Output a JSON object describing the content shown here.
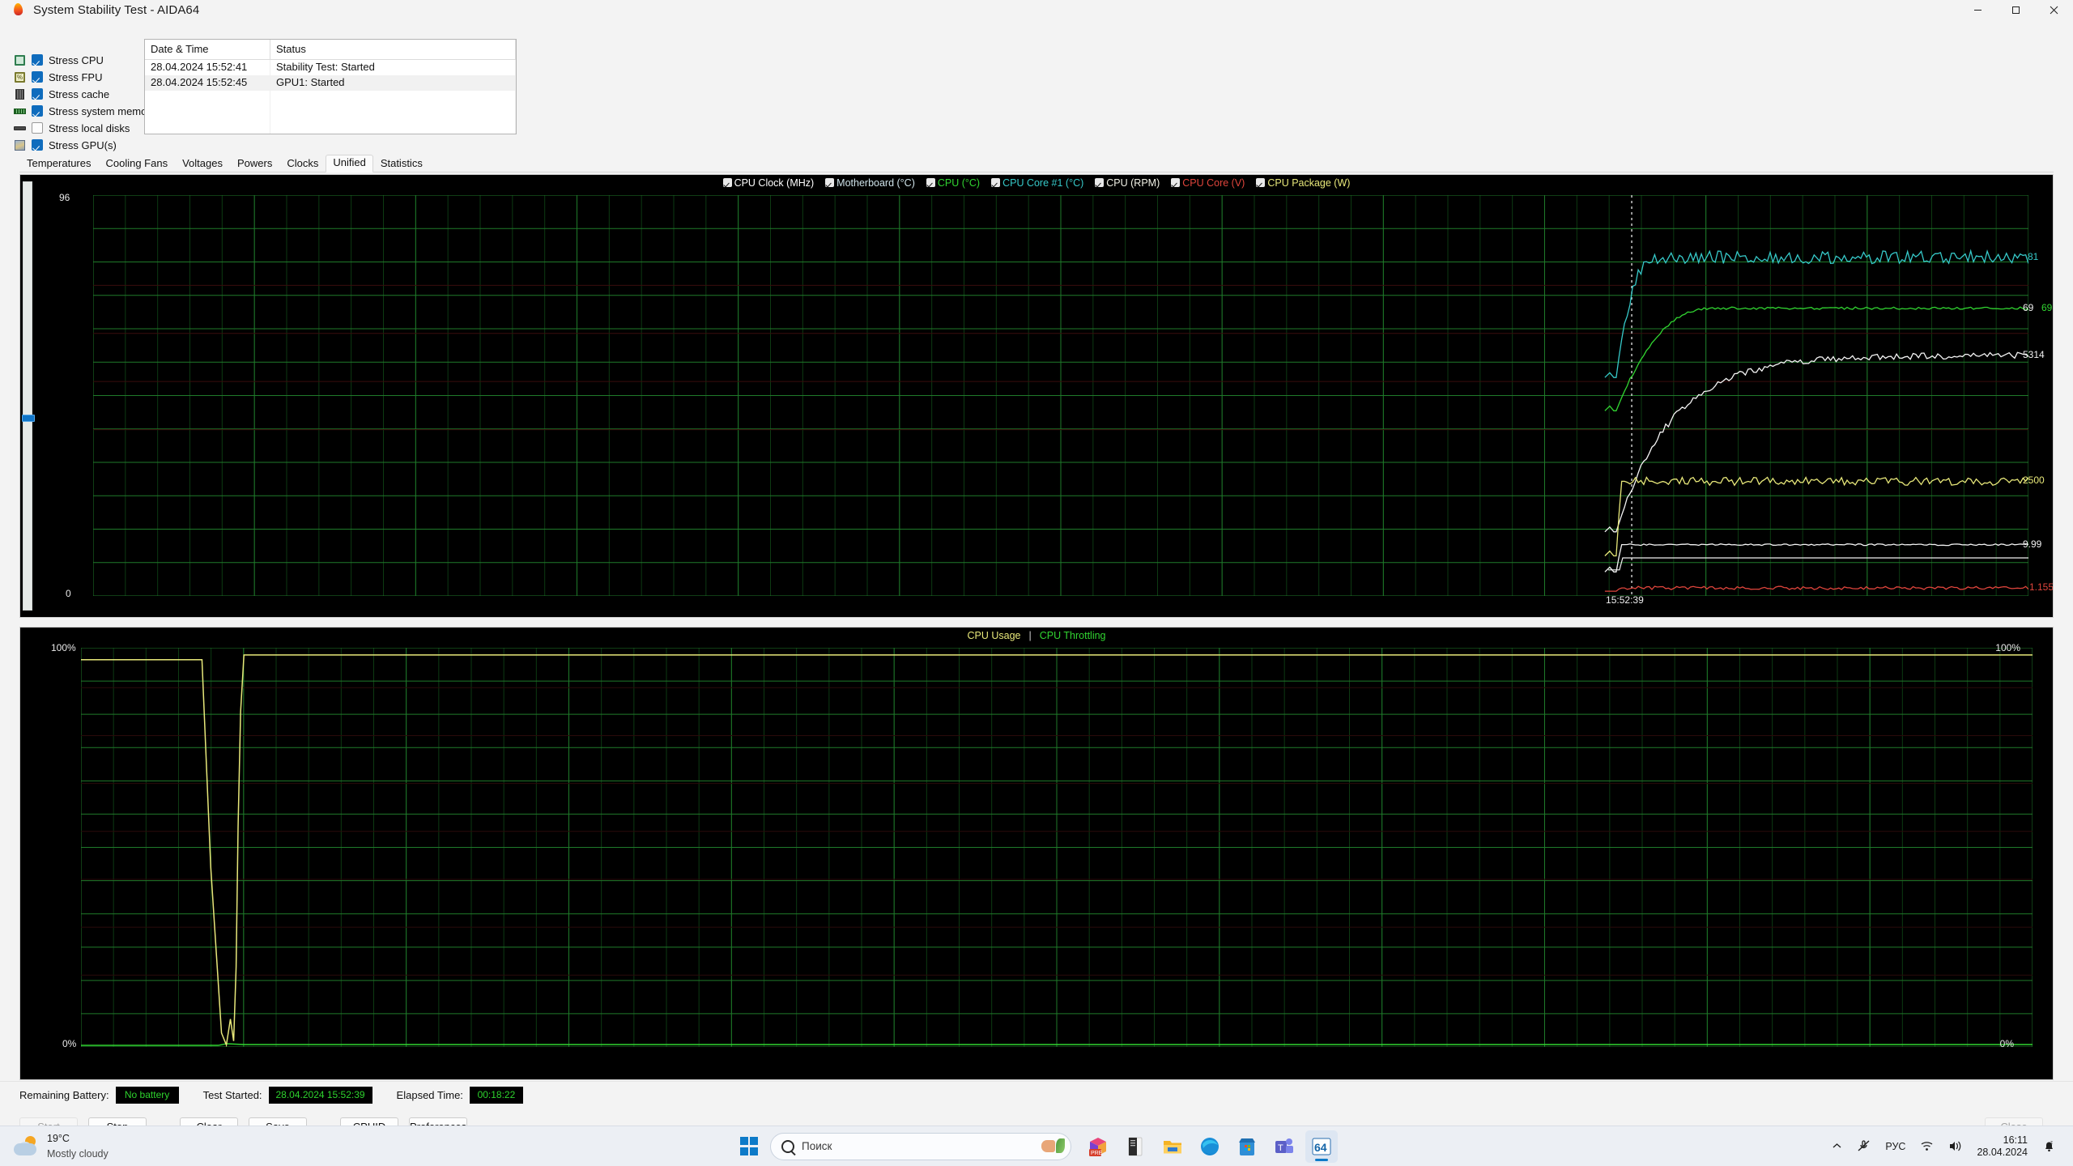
{
  "window": {
    "title": "System Stability Test - AIDA64",
    "icon": "aida64-flame-icon",
    "caption": {
      "minimize": "minimize-icon",
      "maximize": "maximize-icon",
      "close": "close-icon"
    }
  },
  "stress": {
    "items": [
      {
        "label": "Stress CPU",
        "checked": true,
        "icon": "cpu-chip-icon"
      },
      {
        "label": "Stress FPU",
        "checked": true,
        "icon": "fpu-percent-icon"
      },
      {
        "label": "Stress cache",
        "checked": true,
        "icon": "cache-icon"
      },
      {
        "label": "Stress system memory",
        "checked": true,
        "icon": "memory-module-icon"
      },
      {
        "label": "Stress local disks",
        "checked": false,
        "icon": "hard-disk-icon"
      },
      {
        "label": "Stress GPU(s)",
        "checked": true,
        "icon": "gpu-card-icon"
      }
    ]
  },
  "log": {
    "columns": [
      "Date & Time",
      "Status"
    ],
    "rows": [
      {
        "datetime": "28.04.2024 15:52:41",
        "status": "Stability Test: Started"
      },
      {
        "datetime": "28.04.2024 15:52:45",
        "status": "GPU1: Started"
      }
    ]
  },
  "tabs": [
    {
      "label": "Temperatures",
      "active": false
    },
    {
      "label": "Cooling Fans",
      "active": false
    },
    {
      "label": "Voltages",
      "active": false
    },
    {
      "label": "Powers",
      "active": false
    },
    {
      "label": "Clocks",
      "active": false
    },
    {
      "label": "Unified",
      "active": true
    },
    {
      "label": "Statistics",
      "active": false
    }
  ],
  "chart_data": [
    {
      "id": "unified",
      "type": "line",
      "title": "Unified sensor graph",
      "grid": true,
      "legend_position": "top-center",
      "xlabel": "",
      "ylabel": "",
      "ylim": [
        0,
        96
      ],
      "yticks": [
        "0",
        "96"
      ],
      "x_time_marker": "15:52:39",
      "axis_top_label": "96",
      "axis_bottom_label": "0",
      "legend": [
        {
          "label": "CPU Clock (MHz)",
          "color": "#ffffff",
          "checked": true
        },
        {
          "label": "Motherboard (°C)",
          "color": "#cfe3ea",
          "checked": true
        },
        {
          "label": "CPU (°C)",
          "color": "#31d531",
          "checked": true
        },
        {
          "label": "CPU Core #1 (°C)",
          "color": "#36c9c9",
          "checked": true
        },
        {
          "label": "CPU (RPM)",
          "color": "#f2f2e6",
          "checked": true
        },
        {
          "label": "CPU Core (V)",
          "color": "#e0453c",
          "checked": true
        },
        {
          "label": "CPU Package (W)",
          "color": "#e8e87a",
          "checked": true
        }
      ],
      "series": [
        {
          "name": "CPU Core #1 (°C)",
          "color": "#36c9c9",
          "right_label": "81",
          "label_color": "#36c9c9",
          "plateau_frac": 0.845,
          "start_frac": 0.545,
          "noise": 0.016,
          "rise": "fast"
        },
        {
          "name": "CPU (°C)",
          "color": "#31d531",
          "right_label": "69",
          "label_color": "#31d531",
          "plateau_frac": 0.718,
          "start_frac": 0.462,
          "noise": 0.003,
          "rise": "step"
        },
        {
          "name": "Motherboard (°C)",
          "color": "#f4f4f4",
          "right_label": "69",
          "label_color": "#f0f0f0",
          "plateau_frac": 0.6,
          "start_frac": 0.16,
          "noise": 0.008,
          "rise": "slow"
        },
        {
          "name": "CPU Package (W)",
          "color": "#e8e87a",
          "right_label": "2500",
          "label_color": "#e8e87a",
          "plateau_frac": 0.286,
          "start_frac": 0.1,
          "noise": 0.01,
          "rise": "jump"
        },
        {
          "name": "CPU (RPM)",
          "color": "#f4f4f4",
          "right_label": "5314",
          "label_color": "#f0f0f0",
          "plateau_frac": 0.128,
          "start_frac": 0.06,
          "noise": 0.002,
          "rise": "jump"
        },
        {
          "name": "CPU Core (V)",
          "color": "#e0453c",
          "right_label": "1.155",
          "label_color": "#e0453c",
          "plateau_frac": 0.02,
          "start_frac": 0.012,
          "noise": 0.004,
          "rise": "flat"
        }
      ],
      "right_labels": [
        "81",
        "69",
        "69",
        "5314",
        "2500",
        "9.99",
        "1.155"
      ],
      "extra_right_label": {
        "text": "9.99",
        "color": "#f0f0f0"
      }
    },
    {
      "id": "cpu-usage",
      "type": "line",
      "title_parts": [
        {
          "text": "CPU Usage",
          "color": "#e8e87a"
        },
        {
          "text": "|",
          "color": "#cccccc"
        },
        {
          "text": "CPU Throttling",
          "color": "#31d531"
        }
      ],
      "grid": true,
      "ylim": [
        0,
        100
      ],
      "ylabel_top": "100%",
      "ylabel_bottom": "0%",
      "right_label_top": "100%",
      "right_label_bottom": "0%",
      "series": [
        {
          "name": "CPU Usage",
          "color": "#e8e87a",
          "value": 100,
          "unit": "%"
        },
        {
          "name": "CPU Throttling",
          "color": "#31d531",
          "value": 0,
          "unit": "%"
        }
      ]
    }
  ],
  "statusbar": {
    "battery_label": "Remaining Battery:",
    "battery_value": "No battery",
    "started_label": "Test Started:",
    "started_value": "28.04.2024 15:52:39",
    "elapsed_label": "Elapsed Time:",
    "elapsed_value": "00:18:22"
  },
  "buttons": [
    {
      "label": "Start",
      "disabled": true,
      "gap": false
    },
    {
      "label": "Stop",
      "disabled": false,
      "gap": false
    },
    {
      "label": "Clear",
      "disabled": false,
      "gap": true
    },
    {
      "label": "Save",
      "disabled": false,
      "gap": false
    },
    {
      "label": "CPUID",
      "disabled": false,
      "gap": true
    },
    {
      "label": "Preferences",
      "disabled": false,
      "gap": false
    }
  ],
  "close_button": {
    "label": "Close",
    "disabled": true
  },
  "taskbar": {
    "weather": {
      "temp": "19°C",
      "desc": "Mostly cloudy",
      "icon": "sun-behind-cloud-icon"
    },
    "start": "windows-start-icon",
    "search_placeholder": "Поиск",
    "apps": [
      {
        "name": "office-pre-icon",
        "active": false
      },
      {
        "name": "explorer-doc-icon",
        "active": false
      },
      {
        "name": "file-explorer-icon",
        "active": false
      },
      {
        "name": "edge-browser-icon",
        "active": false
      },
      {
        "name": "microsoft-store-icon",
        "active": false
      },
      {
        "name": "teams-icon",
        "active": false
      },
      {
        "name": "aida64-icon",
        "active": true,
        "badge": "64"
      }
    ],
    "tray": {
      "overflow": "chevron-up-icon",
      "mic": "microphone-muted-icon",
      "language": "РУС",
      "wifi": "wifi-icon",
      "volume": "speaker-icon",
      "time": "16:11",
      "date": "28.04.2024",
      "notifications": "notification-bell-icon"
    }
  }
}
